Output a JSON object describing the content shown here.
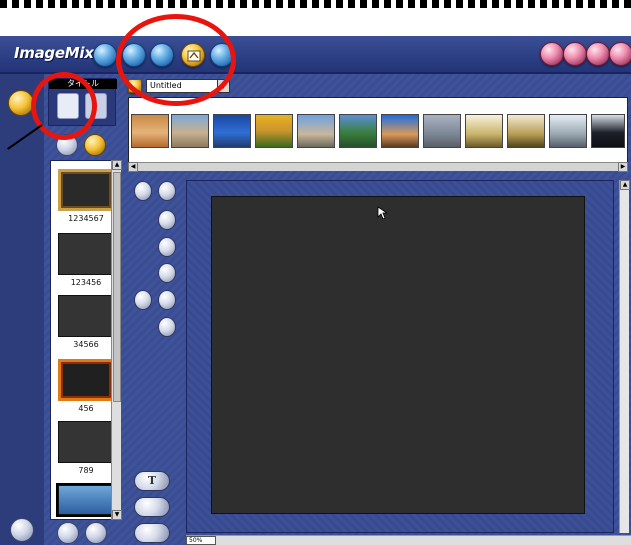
{
  "app": {
    "title": "ImageMixer"
  },
  "project": {
    "selected": "Untitled"
  },
  "mode_panel": {
    "label": "タイトル"
  },
  "thumbnails": [
    {
      "name": "1234567"
    },
    {
      "name": "123456"
    },
    {
      "name": "34566"
    },
    {
      "name": "456"
    },
    {
      "name": "789"
    },
    {
      "name": ""
    }
  ],
  "toolbar": {
    "text_button": "T"
  },
  "status": {
    "zoom": "50%"
  },
  "colors": {
    "accent": "#e8150f",
    "chrome": "#3b4f96",
    "canvas": "#2e2e2e"
  }
}
